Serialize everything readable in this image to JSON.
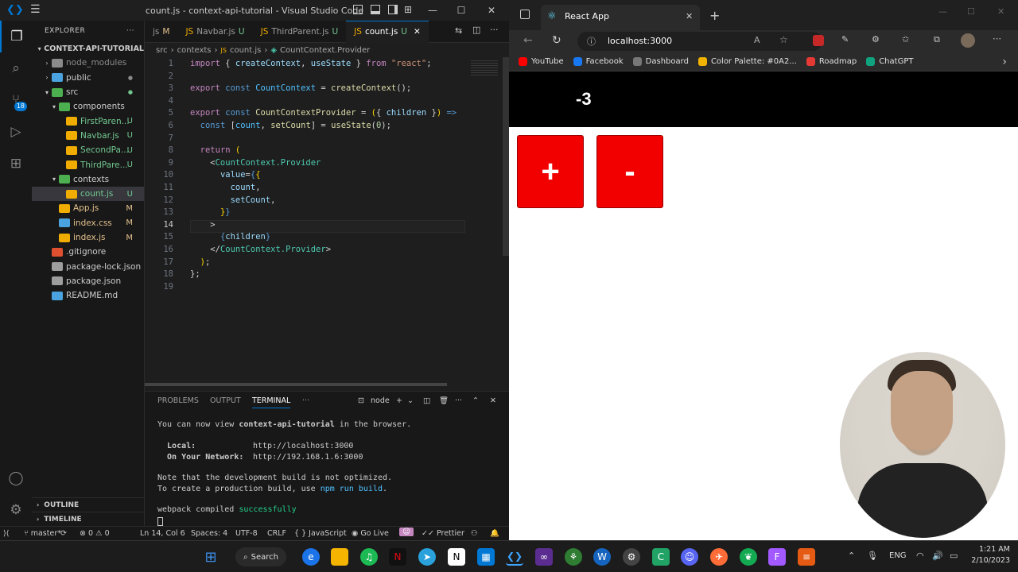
{
  "vscode": {
    "title": "count.js - context-api-tutorial - Visual Studio Code",
    "explorer_label": "EXPLORER",
    "project": "CONTEXT-API-TUTORIAL",
    "tree": [
      {
        "label": "node_modules",
        "depth": 1,
        "kind": "folder",
        "status": "",
        "color": "#8b8b8b"
      },
      {
        "label": "public",
        "depth": 1,
        "kind": "folder",
        "status": "",
        "color": "#4aa3df"
      },
      {
        "label": "src",
        "depth": 1,
        "kind": "folder-open",
        "status": "",
        "color": "#4caf50"
      },
      {
        "label": "components",
        "depth": 2,
        "kind": "folder-open",
        "status": "",
        "color": "#4caf50"
      },
      {
        "label": "FirstParen...",
        "depth": 3,
        "kind": "file",
        "status": "U",
        "color": "#f0ad00"
      },
      {
        "label": "Navbar.js",
        "depth": 3,
        "kind": "file",
        "status": "U",
        "color": "#f0ad00"
      },
      {
        "label": "SecondPa...",
        "depth": 3,
        "kind": "file",
        "status": "U",
        "color": "#f0ad00"
      },
      {
        "label": "ThirdPare...",
        "depth": 3,
        "kind": "file",
        "status": "U",
        "color": "#f0ad00"
      },
      {
        "label": "contexts",
        "depth": 2,
        "kind": "folder-open",
        "status": "",
        "color": "#4caf50"
      },
      {
        "label": "count.js",
        "depth": 3,
        "kind": "file",
        "status": "U",
        "color": "#f0ad00",
        "selected": true
      },
      {
        "label": "App.js",
        "depth": 2,
        "kind": "file",
        "status": "M",
        "color": "#f0ad00"
      },
      {
        "label": "index.css",
        "depth": 2,
        "kind": "file",
        "status": "M",
        "color": "#4aa3df"
      },
      {
        "label": "index.js",
        "depth": 2,
        "kind": "file",
        "status": "M",
        "color": "#f0ad00"
      },
      {
        "label": ".gitignore",
        "depth": 1,
        "kind": "file",
        "status": "",
        "color": "#e05030"
      },
      {
        "label": "package-lock.json",
        "depth": 1,
        "kind": "file",
        "status": "",
        "color": "#9e9e9e"
      },
      {
        "label": "package.json",
        "depth": 1,
        "kind": "file",
        "status": "",
        "color": "#9e9e9e"
      },
      {
        "label": "README.md",
        "depth": 1,
        "kind": "file",
        "status": "",
        "color": "#4aa3df"
      }
    ],
    "outline_label": "OUTLINE",
    "timeline_label": "TIMELINE",
    "tabs": [
      {
        "label": "js",
        "status": "M"
      },
      {
        "label": "Navbar.js",
        "status": "U"
      },
      {
        "label": "ThirdParent.js",
        "status": "U"
      },
      {
        "label": "count.js",
        "status": "U",
        "active": true
      }
    ],
    "breadcrumb": [
      "src",
      "contexts",
      "count.js",
      "CountContext.Provider"
    ],
    "terminal_tabs": [
      "PROBLEMS",
      "OUTPUT",
      "TERMINAL"
    ],
    "terminal_shell": "node",
    "terminal": {
      "l1a": "You can now view ",
      "l1b": "context-api-tutorial",
      "l1c": " in the browser.",
      "local_label": "  Local:",
      "local_url": "http://localhost:3000",
      "network_label": "  On Your Network:",
      "network_url": "http://192.168.1.6:3000",
      "note1": "Note that the development build is not optimized.",
      "note2a": "To create a production build, use ",
      "note2b": "npm run build",
      "note2c": ".",
      "compiled_a": "webpack compiled ",
      "compiled_b": "successfully"
    },
    "status": {
      "branch": "master*",
      "errors": "0",
      "warnings": "0",
      "position": "Ln 14, Col 6",
      "spaces": "Spaces: 4",
      "encoding": "UTF-8",
      "eol": "CRLF",
      "language": "JavaScript",
      "golive": "Go Live",
      "prettier": "Prettier"
    },
    "source_control_badge": "18"
  },
  "browser": {
    "tab_title": "React App",
    "url": "localhost:3000",
    "bookmarks": [
      {
        "label": "YouTube",
        "color": "#ff0000"
      },
      {
        "label": "Facebook",
        "color": "#1877f2"
      },
      {
        "label": "Dashboard",
        "color": "#777777"
      },
      {
        "label": "Color Palette: #0A2...",
        "color": "#f0b400"
      },
      {
        "label": "Roadmap",
        "color": "#e53935"
      },
      {
        "label": "ChatGPT",
        "color": "#10a37f"
      }
    ],
    "count_value": "-3",
    "increment_label": "+",
    "decrement_label": "-",
    "button_color": "#f20000"
  },
  "taskbar": {
    "search_label": "Search",
    "lang": "ENG",
    "time": "1:21 AM",
    "date": "2/10/2023"
  }
}
